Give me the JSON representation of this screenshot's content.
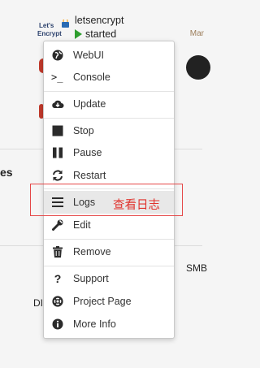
{
  "app": {
    "name": "letsencrypt",
    "status": "started"
  },
  "logo": {
    "line1": "Let's",
    "line2": "Encrypt"
  },
  "background": {
    "left_frag": "es",
    "right_frag": "SMB",
    "left_frag2": "DI",
    "right_logo_frag": "Mar"
  },
  "menu": {
    "items": [
      {
        "label": "WebUI",
        "icon": "globe-icon"
      },
      {
        "label": "Console",
        "icon": "terminal-icon"
      },
      {
        "label": "Update",
        "icon": "cloud-download-icon"
      },
      {
        "label": "Stop",
        "icon": "stop-icon"
      },
      {
        "label": "Pause",
        "icon": "pause-icon"
      },
      {
        "label": "Restart",
        "icon": "refresh-icon"
      },
      {
        "label": "Logs",
        "icon": "list-icon"
      },
      {
        "label": "Edit",
        "icon": "wrench-icon"
      },
      {
        "label": "Remove",
        "icon": "trash-icon"
      },
      {
        "label": "Support",
        "icon": "question-icon"
      },
      {
        "label": "Project Page",
        "icon": "lifebuoy-icon"
      },
      {
        "label": "More Info",
        "icon": "info-icon"
      }
    ]
  },
  "annotation": {
    "text": "查看日志",
    "color": "#e0322c"
  }
}
